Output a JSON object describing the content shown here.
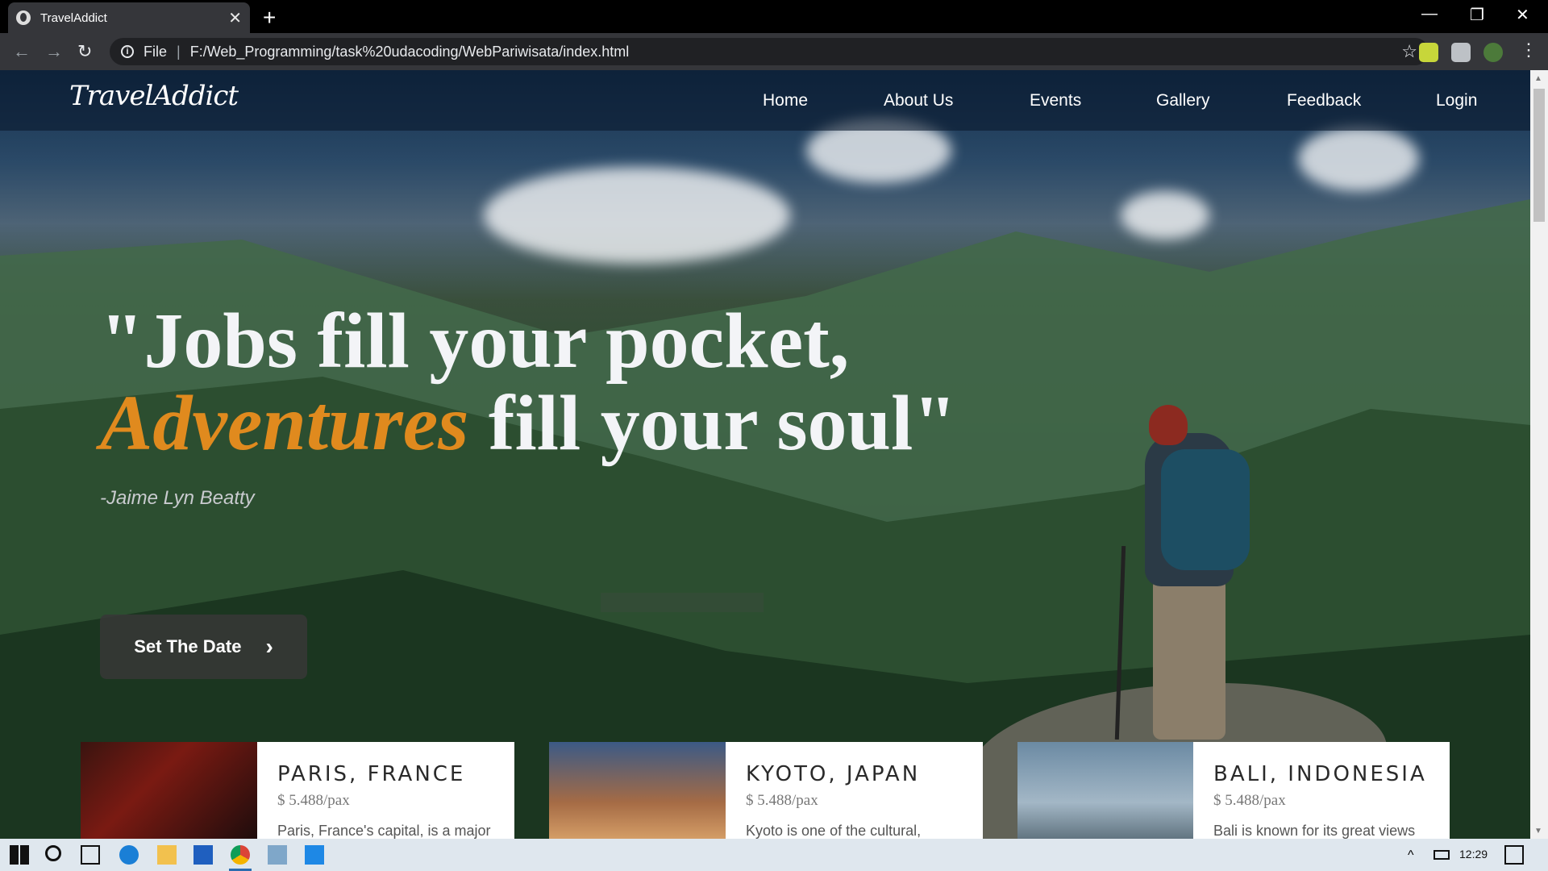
{
  "browser": {
    "tab_title": "TravelAddict",
    "new_tab_symbol": "+",
    "close_symbol": "✕",
    "file_label": "File",
    "url": "F:/Web_Programming/task%20udacoding/WebPariwisata/index.html",
    "window_controls": [
      "—",
      "❐",
      "✕"
    ]
  },
  "site": {
    "logo": "TravelAddict",
    "menu": [
      "Home",
      "About Us",
      "Events",
      "Gallery",
      "Feedback",
      "Login"
    ]
  },
  "hero": {
    "quote_line1": "\"Jobs fill your pocket,",
    "quote_accent": "Adventures",
    "quote_line2_rest": " fill your soul\"",
    "author": "-Jaime Lyn Beatty",
    "cta_label": "Set The Date",
    "cta_icon": "chevron-right-icon",
    "accent_color": "#e08a1e"
  },
  "cards": [
    {
      "title": "PARIS, FRANCE",
      "price": "$ 5.488/pax",
      "desc": "Paris, France's capital, is a major"
    },
    {
      "title": "KYOTO, JAPAN",
      "price": "$ 5.488/pax",
      "desc": "Kyoto is one of the cultural,"
    },
    {
      "title": "BALI, INDONESIA",
      "price": "$ 5.488/pax",
      "desc": "Bali is known for its great views"
    }
  ],
  "taskbar": {
    "time": "12:29"
  }
}
